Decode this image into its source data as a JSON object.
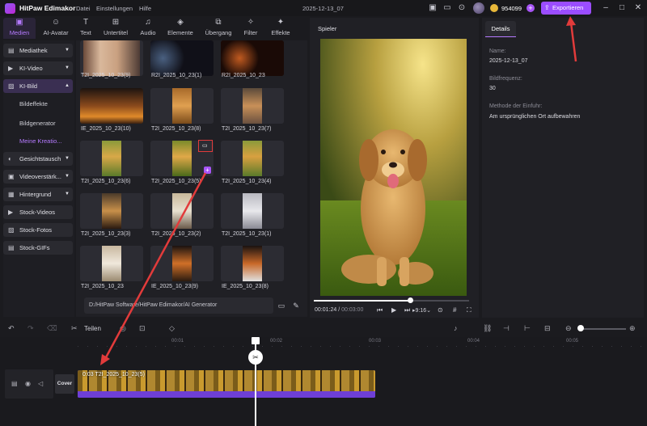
{
  "titlebar": {
    "app_name": "HitPaw Edimakor",
    "menu": [
      "Datei",
      "Einstellungen",
      "Hilfe"
    ],
    "project_title": "2025-12-13_07",
    "credits": "954099",
    "export_label": "Exportieren"
  },
  "tools": [
    {
      "label": "Medien",
      "icon": "media-icon",
      "active": true
    },
    {
      "label": "AI-Avatar",
      "icon": "avatar-icon"
    },
    {
      "label": "Text",
      "icon": "text-icon"
    },
    {
      "label": "Untertitel",
      "icon": "subtitle-icon"
    },
    {
      "label": "Audio",
      "icon": "audio-icon"
    },
    {
      "label": "Elemente",
      "icon": "elements-icon"
    },
    {
      "label": "Übergang",
      "icon": "transition-icon"
    },
    {
      "label": "Filter",
      "icon": "filter-icon"
    },
    {
      "label": "Effekte",
      "icon": "effects-icon"
    }
  ],
  "sidebar": {
    "items": [
      {
        "label": "Mediathek",
        "icon": "library-icon"
      },
      {
        "label": "KI-Video",
        "icon": "ai-video-icon"
      },
      {
        "label": "KI-Bild",
        "icon": "ai-image-icon",
        "active": true
      },
      {
        "label": "Gesichtstausch",
        "icon": "face-swap-icon"
      },
      {
        "label": "Videoverstärk...",
        "icon": "enhance-icon"
      },
      {
        "label": "Hintergrund",
        "icon": "background-icon"
      },
      {
        "label": "Stock-Videos",
        "icon": "stock-video-icon"
      },
      {
        "label": "Stock-Fotos",
        "icon": "stock-photo-icon"
      },
      {
        "label": "Stock-GIFs",
        "icon": "stock-gif-icon"
      }
    ],
    "subitems": [
      "Bildeffekte",
      "Bildgenerator",
      "Meine Kreatio..."
    ]
  },
  "media": {
    "items": [
      {
        "label": "T2I_2025_10_23(9)"
      },
      {
        "label": "R2I_2025_10_23(1)"
      },
      {
        "label": "R2I_2025_10_23"
      },
      {
        "label": "IE_2025_10_23(10)"
      },
      {
        "label": "T2I_2025_10_23(8)"
      },
      {
        "label": "T2I_2025_10_23(7)"
      },
      {
        "label": "T2I_2025_10_23(6)"
      },
      {
        "label": "T2I_2025_10_23(5)"
      },
      {
        "label": "T2I_2025_10_23(4)"
      },
      {
        "label": "T2I_2025_10_23(3)"
      },
      {
        "label": "T2I_2025_10_23(2)"
      },
      {
        "label": "T2I_2025_10_23(1)"
      },
      {
        "label": "T2I_2025_10_23"
      },
      {
        "label": "IE_2025_10_23(9)"
      },
      {
        "label": "IE_2025_10_23(8)"
      }
    ],
    "path": "D:/HitPaw Software/HitPaw Edimakor/AI Generator"
  },
  "player": {
    "title": "Spieler",
    "current_time": "00:01:24",
    "total_time": "00:03:00",
    "progress": 0.62,
    "aspect": "9:16"
  },
  "details": {
    "tab": "Details",
    "fields": [
      {
        "label": "Name:",
        "value": "2025-12-13_07"
      },
      {
        "label": "Bildfrequenz:",
        "value": "30"
      },
      {
        "label": "Methode der Einfuhr:",
        "value": "Am ursprünglichen Ort aufbewahren"
      }
    ]
  },
  "timeline": {
    "split_label": "Teilen",
    "ruler": [
      "00:01",
      "00:02",
      "00:03",
      "00:04",
      "00:05"
    ],
    "cover_label": "Cover",
    "clip_label": "0:03  T2I_2025_10_23(5)"
  }
}
